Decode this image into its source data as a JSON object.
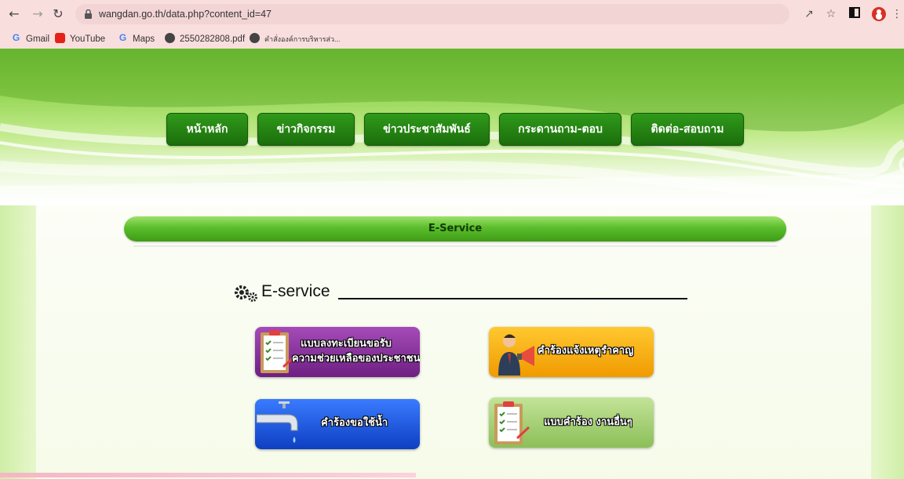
{
  "browser": {
    "url": "wangdan.go.th/data.php?content_id=47",
    "bookmarks": [
      {
        "label": "Gmail",
        "icon": "google-icon"
      },
      {
        "label": "YouTube",
        "icon": "youtube-icon"
      },
      {
        "label": "Maps",
        "icon": "google-icon"
      },
      {
        "label": "2550282808.pdf",
        "icon": "globe-icon"
      },
      {
        "label": "คำสั่งองค์การบริหารส่ว...",
        "icon": "globe-icon"
      }
    ]
  },
  "nav": {
    "items": [
      {
        "label": "หน้าหลัก"
      },
      {
        "label": "ข่าวกิจกรรม"
      },
      {
        "label": "ข่าวประชาสัมพันธ์"
      },
      {
        "label": "กระดานถาม-ตอบ"
      },
      {
        "label": "ติดต่อ-สอบถาม"
      }
    ]
  },
  "section_bar": "E-Service",
  "heading": "E-service",
  "services": [
    {
      "label_line1": "แบบลงทะเบียนขอรับ",
      "label_line2": "ความช่วยเหลือของประชาชน",
      "icon": "clipboard-icon",
      "color": "#8b2f9e"
    },
    {
      "label_line1": "คำร้องแจ้งเหตุรำคาญ",
      "label_line2": "",
      "icon": "megaphone-man-icon",
      "color": "#f5a300"
    },
    {
      "label_line1": "คำร้องขอใช้น้ำ",
      "label_line2": "",
      "icon": "water-tap-icon",
      "color": "#1f54d8"
    },
    {
      "label_line1": "แบบคำร้อง งานอื่นๆ",
      "label_line2": "",
      "icon": "clipboard-icon",
      "color": "#9ccc60"
    }
  ]
}
